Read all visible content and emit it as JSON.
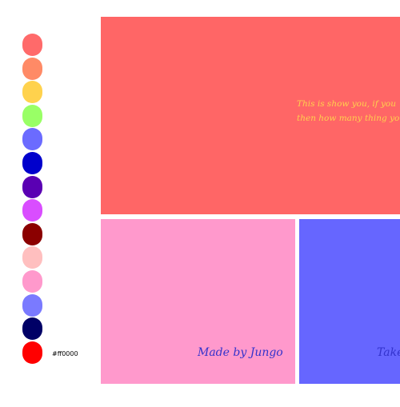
{
  "palette": [
    {
      "name": "swatch-coral",
      "color": "#ff6a6a"
    },
    {
      "name": "swatch-salmon",
      "color": "#ff8a66"
    },
    {
      "name": "swatch-yellow",
      "color": "#ffd24d"
    },
    {
      "name": "swatch-lightgreen",
      "color": "#99ff66"
    },
    {
      "name": "swatch-periwinkle",
      "color": "#6b6bff"
    },
    {
      "name": "swatch-blue",
      "color": "#0000cc"
    },
    {
      "name": "swatch-indigo",
      "color": "#5a00b3"
    },
    {
      "name": "swatch-magenta",
      "color": "#d94dff"
    },
    {
      "name": "swatch-maroon",
      "color": "#8b0000"
    },
    {
      "name": "swatch-pink",
      "color": "#ffbfbf"
    },
    {
      "name": "swatch-rose",
      "color": "#ff99cc"
    },
    {
      "name": "swatch-lavender",
      "color": "#7a7aff"
    },
    {
      "name": "swatch-navy",
      "color": "#000066"
    },
    {
      "name": "swatch-red",
      "color": "#ff0000"
    }
  ],
  "selected_hex": "#ff0000",
  "panels": {
    "top": {
      "background": "#ff6666",
      "text_color": "#ffd24d",
      "line1": "This is show you, if you",
      "line2": "then how many thing you"
    },
    "bottom_left": {
      "background": "#ff99cc",
      "text_color": "#3333cc",
      "signature": "Made by Jungo"
    },
    "bottom_right": {
      "background": "#6666ff",
      "text_color": "#3333cc",
      "signature": "Take"
    }
  }
}
